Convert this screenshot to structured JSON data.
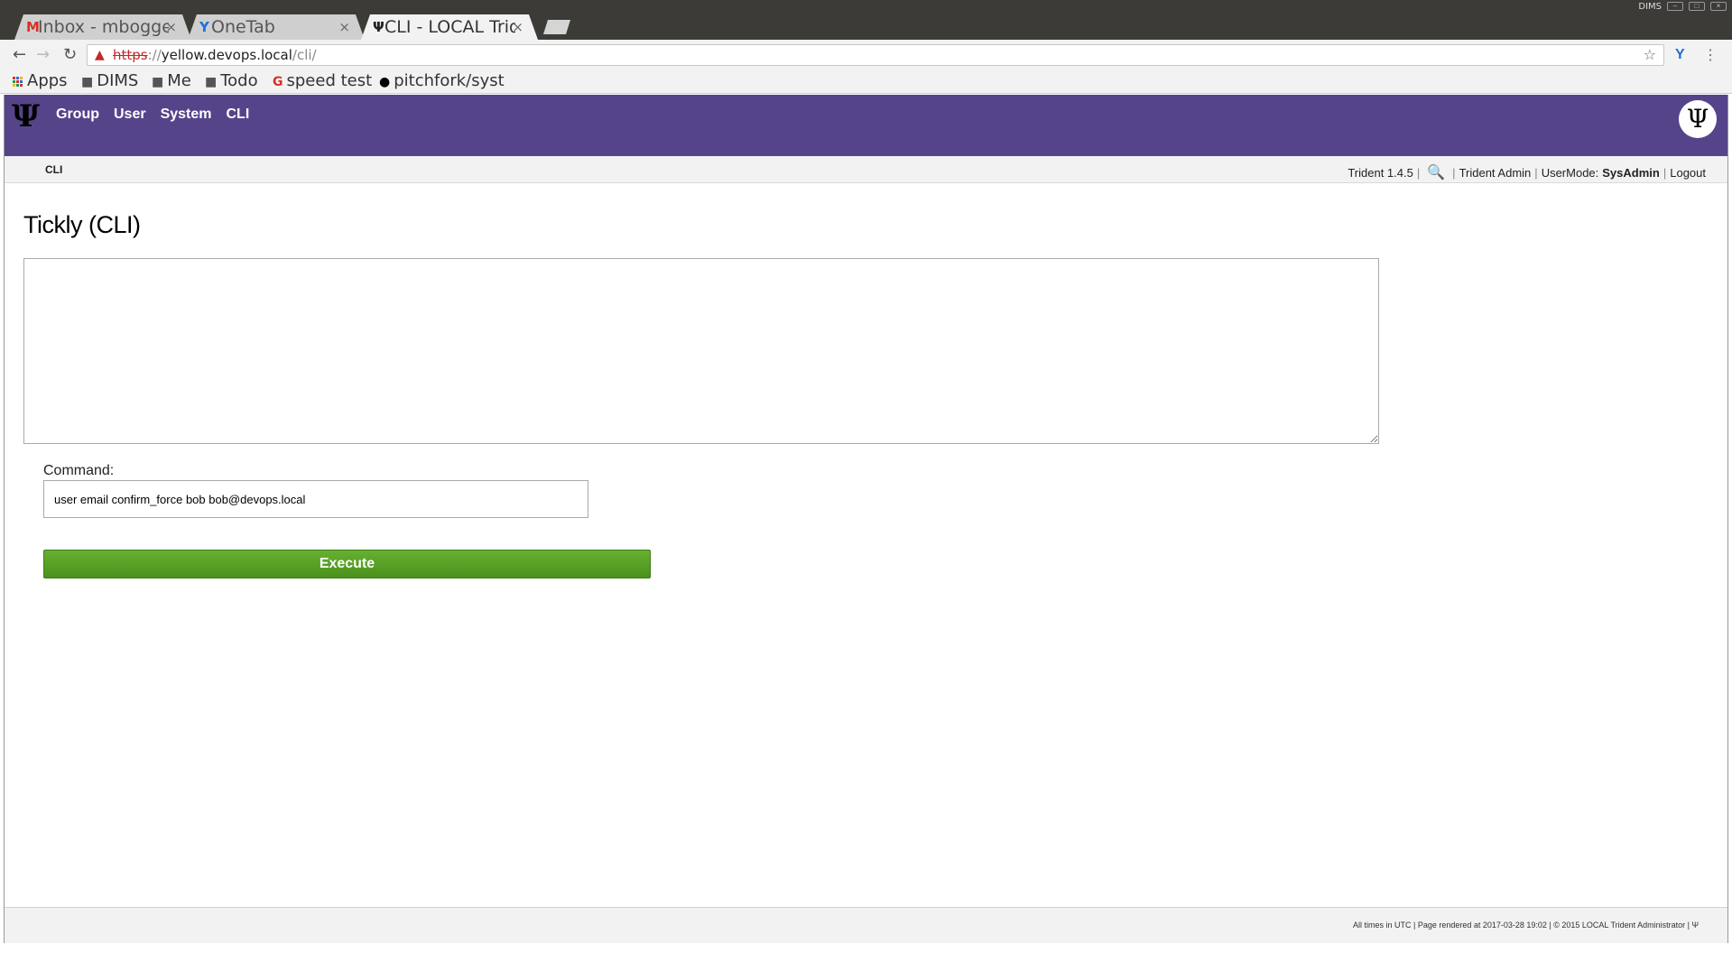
{
  "os": {
    "tray_label": "DIMS"
  },
  "tabs": [
    {
      "icon": "M",
      "title": "Inbox - mbogge",
      "close": "×"
    },
    {
      "icon": "Y",
      "title": "OneTab",
      "close": "×"
    },
    {
      "icon": "Ψ",
      "title": "CLI - LOCAL Trid",
      "close": "×"
    }
  ],
  "omnibox": {
    "scheme": "https",
    "sep": "://",
    "host": "yellow.devops.local",
    "path": "/cli/"
  },
  "bookmarks": [
    {
      "label": "Apps"
    },
    {
      "label": "DIMS"
    },
    {
      "label": "Me"
    },
    {
      "label": "Todo"
    },
    {
      "label": "speed test"
    },
    {
      "label": "pitchfork/syst"
    }
  ],
  "nav": {
    "group": "Group",
    "user": "User",
    "system": "System",
    "cli": "CLI"
  },
  "logo_glyph": "Ψ",
  "breadcrumb": "CLI",
  "userbar": {
    "version": "Trident 1.4.5",
    "user": "Trident Admin",
    "mode_label": "UserMode:",
    "mode_value": "SysAdmin",
    "logout": "Logout"
  },
  "page": {
    "title": "Tickly (CLI)",
    "output": "",
    "command_label": "Command:",
    "command_value": "user email confirm_force bob bob@devops.local",
    "execute": "Execute"
  },
  "footer": "All times in UTC | Page rendered at 2017-03-28 19:02 | © 2015 LOCAL Trident Administrator | Ψ",
  "colors": {
    "header": "#56448a",
    "execute": "#56a326"
  }
}
